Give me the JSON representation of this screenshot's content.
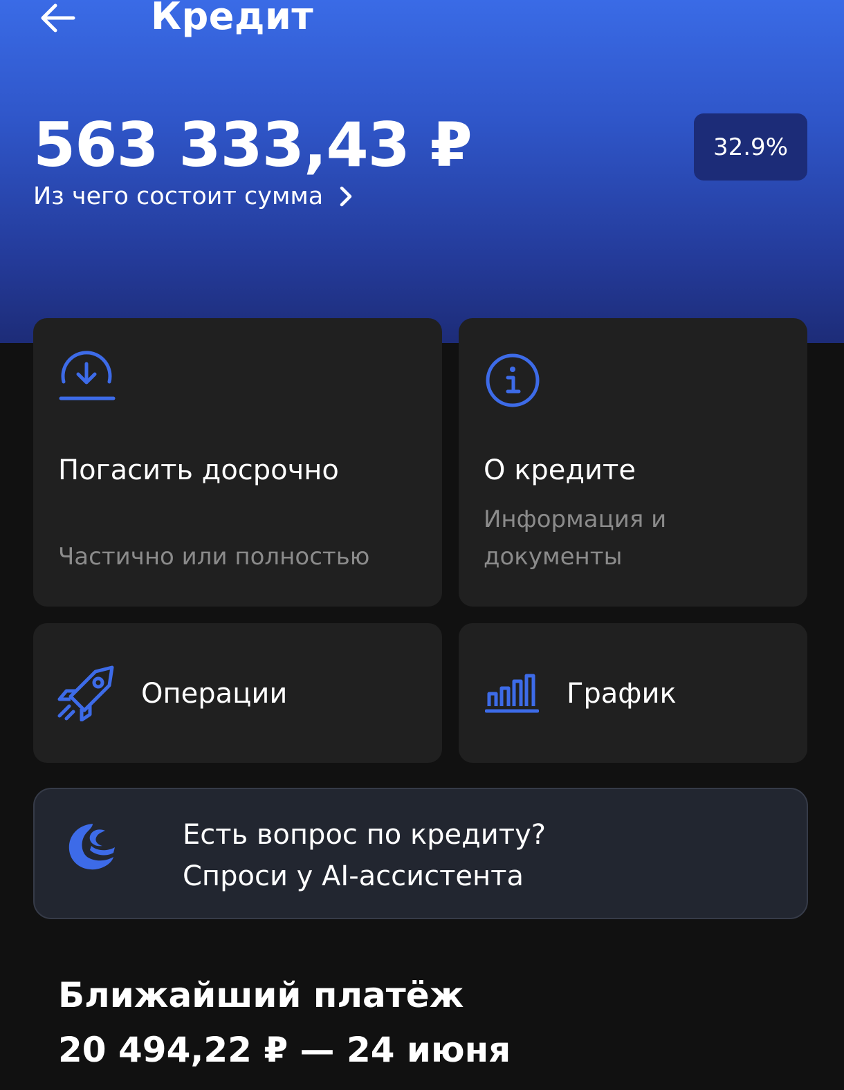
{
  "header": {
    "title": "Кредит",
    "back_icon": "arrow-left-icon"
  },
  "loan": {
    "amount": "563 333,43 ₽",
    "breakdown_link": "Из чего состоит сумма",
    "rate": "32.9%"
  },
  "actions": {
    "early_repay": {
      "title": "Погасить досрочно",
      "subtitle": "Частично или полностью",
      "icon": "download-circle-icon"
    },
    "about": {
      "title": "О кредите",
      "subtitle": "Информация и документы",
      "icon": "info-circle-icon"
    },
    "operations": {
      "label": "Операции",
      "icon": "rocket-icon"
    },
    "schedule": {
      "label": "График",
      "icon": "bar-chart-icon"
    }
  },
  "assistant": {
    "line1": "Есть вопрос по кредиту?",
    "line2": "Спроси у AI-ассистента",
    "icon": "assistant-logo-icon"
  },
  "next_payment": {
    "label": "Ближайший платёж",
    "value": "20 494,22 ₽ — 24 июня"
  },
  "colors": {
    "accent": "#3d6be8",
    "background": "#111111",
    "card": "#202020",
    "muted_text": "#8b8b8b",
    "badge": "#1c2c78"
  }
}
